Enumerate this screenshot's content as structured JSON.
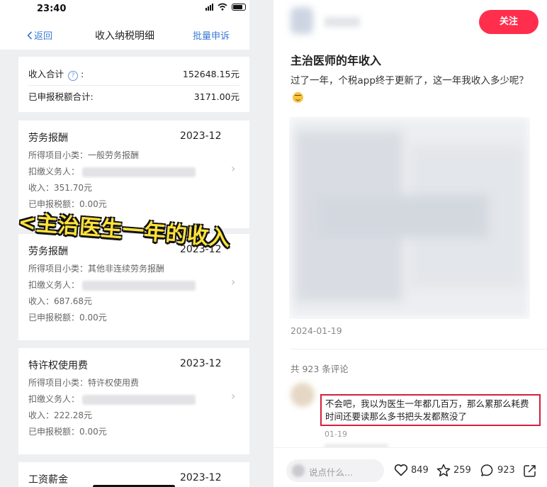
{
  "left_phone": {
    "status_time": "23:40",
    "nav": {
      "back": "返回",
      "title": "收入纳税明细",
      "action": "批量申诉"
    },
    "summary": {
      "income_label": "收入合计",
      "income_value": "152648.15元",
      "tax_label": "已申报税额合计:",
      "tax_value": "3171.00元"
    },
    "records": [
      {
        "title": "劳务报酬",
        "date": "2023-12",
        "subcategory": "所得项目小类：一般劳务报酬",
        "withholder": "扣缴义务人：",
        "income": "收入：351.70元",
        "tax": "已申报税额：0.00元"
      },
      {
        "title": "劳务报酬",
        "date": "2023-12",
        "subcategory": "所得项目小类：其他非连续劳务报酬",
        "withholder": "扣缴义务人：",
        "income": "收入：687.68元",
        "tax": "已申报税额：0.00元"
      },
      {
        "title": "特许权使用费",
        "date": "2023-12",
        "subcategory": "所得项目小类：特许权使用费",
        "withholder": "扣缴义务人：",
        "income": "收入：222.28元",
        "tax": "已申报税额：0.00元"
      },
      {
        "title": "工资薪金",
        "date": "2023-12"
      }
    ],
    "overlay_caption": "<主治医生一年的收入"
  },
  "post": {
    "follow_label": "关注",
    "title": "主治医师的年收入",
    "body": "过了一年，个税app终于更新了，这一年我收入多少呢？",
    "date": "2024-01-19",
    "comment_count": "共 923 条评论",
    "comment": {
      "text": "不会吧，我以为医生一年都几百万，那么累那么耗费时间还要读那么多书把头发都熬没了",
      "date": "01-19"
    },
    "bottom": {
      "input_placeholder": "说点什么...",
      "likes": "849",
      "stars": "259",
      "comments": "923"
    }
  },
  "colors": {
    "accent_blue": "#3a7bd5",
    "follow_red": "#ff2e4d",
    "highlight_red": "#d41f3f",
    "caption_yellow": "#ffe23a"
  },
  "icons": [
    "chevron-left-icon",
    "help-icon",
    "chevron-right-icon",
    "wifi-icon",
    "battery-icon",
    "heart-icon",
    "star-icon",
    "comment-icon",
    "share-icon"
  ]
}
